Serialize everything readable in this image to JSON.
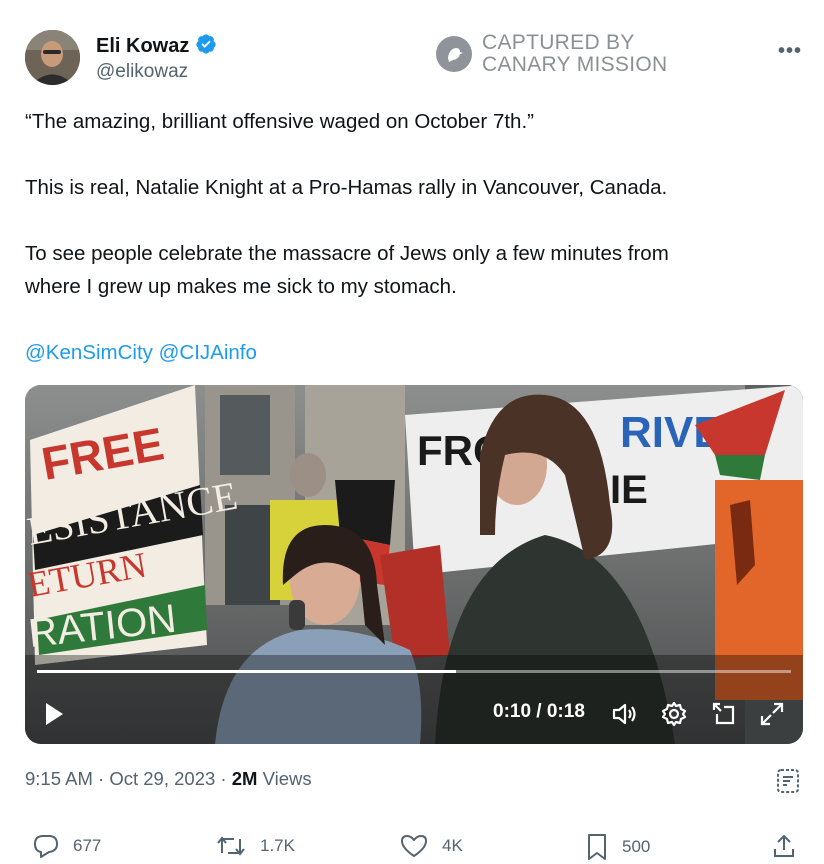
{
  "author": {
    "name": "Eli Kowaz",
    "handle": "@elikowaz",
    "verified": true
  },
  "watermark": {
    "line1": "CAPTURED BY",
    "line2": "CANARY MISSION"
  },
  "tweet": {
    "line1": "“The amazing, brilliant offensive waged on October 7th.”",
    "line2": "This is real, Natalie Knight at a Pro-Hamas rally in Vancouver, Canada.",
    "line3": "To see people celebrate the massacre of Jews only a few minutes from",
    "line4": "where I grew up makes me sick to my stomach.",
    "mention1": "@KenSimCity",
    "mention2": "@CIJAinfo"
  },
  "video": {
    "time_display": "0:10 / 0:18",
    "progress": 0.5556,
    "sign_left": [
      "FREE",
      "ESISTANCE",
      "ETURN",
      "RATION"
    ],
    "sign_right": [
      "FROM",
      "RIVER",
      "IE"
    ]
  },
  "meta": {
    "time": "9:15 AM",
    "date": "Oct 29, 2023",
    "views_count": "2M",
    "views_label": "Views"
  },
  "actions": {
    "replies": "677",
    "reposts": "1.7K",
    "likes": "4K",
    "bookmarks": "500"
  },
  "colors": {
    "accent": "#1d9bf0",
    "text_secondary": "#536471"
  }
}
